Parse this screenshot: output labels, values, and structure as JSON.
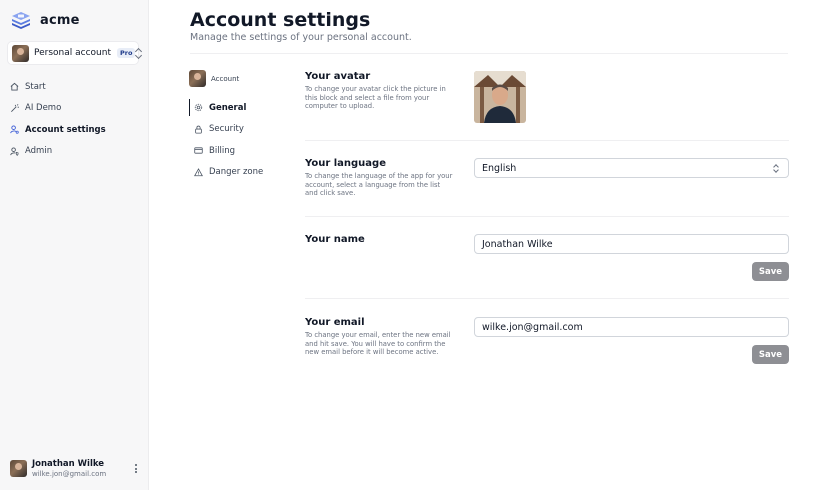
{
  "app": {
    "name": "acme"
  },
  "account_switch": {
    "label": "Personal account",
    "badge": "Pro"
  },
  "nav": [
    {
      "label": "Start",
      "icon": "home-icon"
    },
    {
      "label": "AI Demo",
      "icon": "magic-wand-icon"
    },
    {
      "label": "Account settings",
      "icon": "user-cog-icon",
      "active": true
    },
    {
      "label": "Admin",
      "icon": "user-shield-icon"
    }
  ],
  "user": {
    "name": "Jonathan Wilke",
    "email": "wilke.jon@gmail.com"
  },
  "header": {
    "title": "Account settings",
    "subtitle": "Manage the settings of your personal account."
  },
  "sub_nav": {
    "account_label": "Account",
    "items": [
      {
        "label": "General",
        "icon": "gear-icon",
        "active": true
      },
      {
        "label": "Security",
        "icon": "lock-icon"
      },
      {
        "label": "Billing",
        "icon": "credit-card-icon"
      },
      {
        "label": "Danger zone",
        "icon": "warning-icon"
      }
    ]
  },
  "sections": {
    "avatar": {
      "title": "Your avatar",
      "desc": "To change your avatar click the picture in this block and select a file from your computer to upload."
    },
    "language": {
      "title": "Your language",
      "desc": "To change the language of the app for your account, select a language from the list and click save.",
      "value": "English"
    },
    "name": {
      "title": "Your name",
      "value": "Jonathan Wilke",
      "save_label": "Save"
    },
    "email": {
      "title": "Your email",
      "desc": "To change your email, enter the new email and hit save. You will have to confirm the new email before it will become active.",
      "value": "wilke.jon@gmail.com",
      "save_label": "Save"
    }
  },
  "colors": {
    "accent": "#111827",
    "button": "#8e8f94",
    "logo": "#4f6fd8"
  }
}
